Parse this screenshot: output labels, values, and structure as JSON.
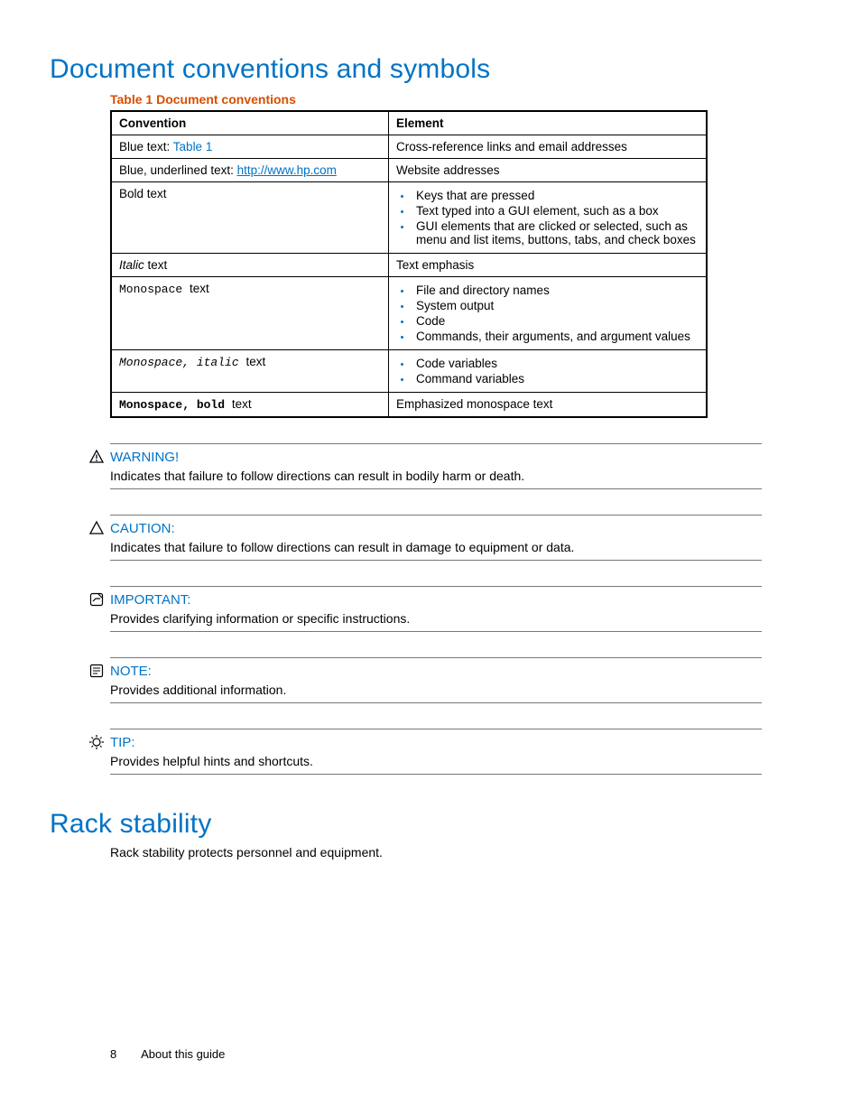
{
  "heading1": "Document conventions and symbols",
  "table_caption": "Table 1 Document conventions",
  "th_convention": "Convention",
  "th_element": "Element",
  "row1_prefix": "Blue text: ",
  "row1_link": "Table 1",
  "row1_element": "Cross-reference links and email addresses",
  "row2_prefix": "Blue, underlined text: ",
  "row2_link": "http://www.hp.com",
  "row2_element": "Website addresses",
  "row3_bold": "Bold",
  "row3_suffix": " text",
  "row3_b1": "Keys that are pressed",
  "row3_b2": "Text typed into a GUI element, such as a box",
  "row3_b3": "GUI elements that are clicked or selected, such as menu and list items, buttons, tabs, and check boxes",
  "row4_italic": "Italic",
  "row4_suffix": " text",
  "row4_element": "Text emphasis",
  "row5_mono": "Monospace ",
  "row5_suffix": "text",
  "row5_b1": "File and directory names",
  "row5_b2": "System output",
  "row5_b3": "Code",
  "row5_b4": "Commands, their arguments, and argument values",
  "row6_mono": "Monospace, italic ",
  "row6_suffix": "text",
  "row6_b1": "Code variables",
  "row6_b2": "Command variables",
  "row7_mono": "Monospace, bold ",
  "row7_suffix": "text",
  "row7_element": "Emphasized monospace text",
  "warning_head": "WARNING!",
  "warning_body": "Indicates that failure to follow directions can result in bodily harm or death.",
  "caution_head": "CAUTION:",
  "caution_body": "Indicates that failure to follow directions can result in damage to equipment or data.",
  "important_head": "IMPORTANT:",
  "important_body": "Provides clarifying information or specific instructions.",
  "note_head": "NOTE:",
  "note_body": "Provides additional information.",
  "tip_head": "TIP:",
  "tip_body": "Provides helpful hints and shortcuts.",
  "heading2": "Rack stability",
  "rack_body": "Rack stability protects personnel and equipment.",
  "page_number": "8",
  "footer_text": "About this guide"
}
